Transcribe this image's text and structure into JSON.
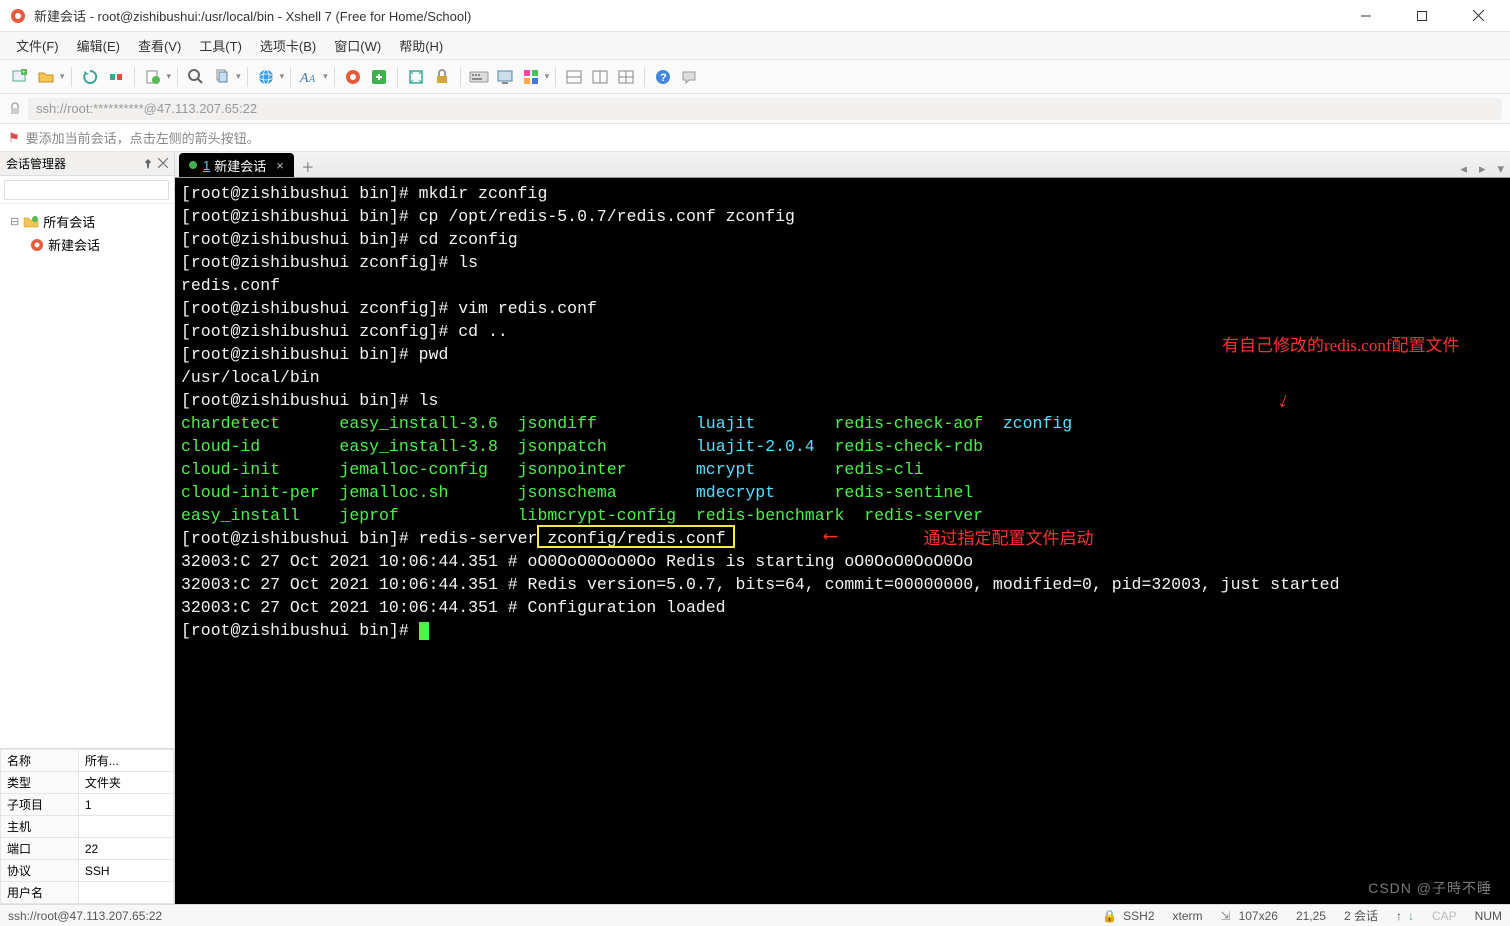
{
  "window": {
    "title": "新建会话 - root@zishibushui:/usr/local/bin - Xshell 7 (Free for Home/School)"
  },
  "menu": {
    "items": [
      "文件(F)",
      "编辑(E)",
      "查看(V)",
      "工具(T)",
      "选项卡(B)",
      "窗口(W)",
      "帮助(H)"
    ]
  },
  "address": {
    "text": "ssh://root:**********@47.113.207.65:22"
  },
  "hint": {
    "text": "要添加当前会话，点击左侧的箭头按钮。"
  },
  "session_manager": {
    "title": "会话管理器",
    "root": "所有会话",
    "child": "新建会话",
    "search_placeholder": ""
  },
  "properties": {
    "rows": [
      [
        "名称",
        "所有..."
      ],
      [
        "类型",
        "文件夹"
      ],
      [
        "子项目",
        "1"
      ],
      [
        "主机",
        ""
      ],
      [
        "端口",
        "22"
      ],
      [
        "协议",
        "SSH"
      ],
      [
        "用户名",
        ""
      ]
    ]
  },
  "tab": {
    "index": "1",
    "label": "新建会话"
  },
  "terminal_lines": [
    {
      "segs": [
        {
          "t": "[root@zishibushui bin]# mkdir zconfig",
          "c": "w"
        }
      ]
    },
    {
      "segs": [
        {
          "t": "[root@zishibushui bin]# cp /opt/redis-5.0.7/redis.conf zconfig",
          "c": "w"
        }
      ]
    },
    {
      "segs": [
        {
          "t": "[root@zishibushui bin]# cd zconfig",
          "c": "w"
        }
      ]
    },
    {
      "segs": [
        {
          "t": "[root@zishibushui zconfig]# ls",
          "c": "w"
        }
      ]
    },
    {
      "segs": [
        {
          "t": "redis.conf",
          "c": "w"
        }
      ]
    },
    {
      "segs": [
        {
          "t": "[root@zishibushui zconfig]# vim redis.conf",
          "c": "w"
        }
      ]
    },
    {
      "segs": [
        {
          "t": "[root@zishibushui zconfig]# cd ..",
          "c": "w"
        }
      ]
    },
    {
      "segs": [
        {
          "t": "[root@zishibushui bin]# pwd",
          "c": "w"
        }
      ]
    },
    {
      "segs": [
        {
          "t": "/usr/local/bin",
          "c": "w"
        }
      ]
    },
    {
      "segs": [
        {
          "t": "[root@zishibushui bin]# ls",
          "c": "w"
        }
      ]
    },
    {
      "segs": [
        {
          "t": "chardetect      easy_install-3.6  jsondiff          ",
          "c": "g"
        },
        {
          "t": "luajit        ",
          "c": "c"
        },
        {
          "t": "redis-check-aof  ",
          "c": "g"
        },
        {
          "t": "zconfig",
          "c": "c"
        }
      ]
    },
    {
      "segs": [
        {
          "t": "cloud-id        easy_install-3.8  jsonpatch         ",
          "c": "g"
        },
        {
          "t": "luajit-2.0.4  ",
          "c": "c"
        },
        {
          "t": "redis-check-rdb",
          "c": "g"
        }
      ]
    },
    {
      "segs": [
        {
          "t": "cloud-init      jemalloc-config   jsonpointer       ",
          "c": "g"
        },
        {
          "t": "mcrypt        ",
          "c": "c"
        },
        {
          "t": "redis-cli",
          "c": "g"
        }
      ]
    },
    {
      "segs": [
        {
          "t": "cloud-init-per  jemalloc.sh       jsonschema        ",
          "c": "g"
        },
        {
          "t": "mdecrypt      ",
          "c": "c"
        },
        {
          "t": "redis-sentinel",
          "c": "g"
        }
      ]
    },
    {
      "segs": [
        {
          "t": "easy_install    jeprof            libmcrypt-config  redis-benchmark  redis-server",
          "c": "g"
        }
      ]
    },
    {
      "segs": [
        {
          "t": "[root@zishibushui bin]# redis-server zconfig/redis.conf",
          "c": "w"
        }
      ]
    },
    {
      "segs": [
        {
          "t": "32003:C 27 Oct 2021 10:06:44.351 # oO0OoO0OoO0Oo Redis is starting oO0OoO0OoO0Oo",
          "c": "w"
        }
      ]
    },
    {
      "segs": [
        {
          "t": "32003:C 27 Oct 2021 10:06:44.351 # Redis version=5.0.7, bits=64, commit=00000000, modified=0, pid=32003, just started",
          "c": "w"
        }
      ]
    },
    {
      "segs": [
        {
          "t": "32003:C 27 Oct 2021 10:06:44.351 # Configuration loaded",
          "c": "w"
        }
      ]
    },
    {
      "segs": [
        {
          "t": "[root@zishibushui bin]# ",
          "c": "w"
        },
        {
          "t": "",
          "c": "cursor"
        }
      ]
    }
  ],
  "annotations": {
    "a1": "有自己修改的redis.conf配置文件",
    "a2": "通过指定配置文件启动"
  },
  "status": {
    "path": "ssh://root@47.113.207.65:22",
    "proto": "SSH2",
    "term": "xterm",
    "size": "107x26",
    "cursor": "21,25",
    "sessions": "2 会话",
    "cap": "CAP",
    "num": "NUM",
    "conn_icon": "↑",
    "watermark": "CSDN @子時不睡"
  }
}
